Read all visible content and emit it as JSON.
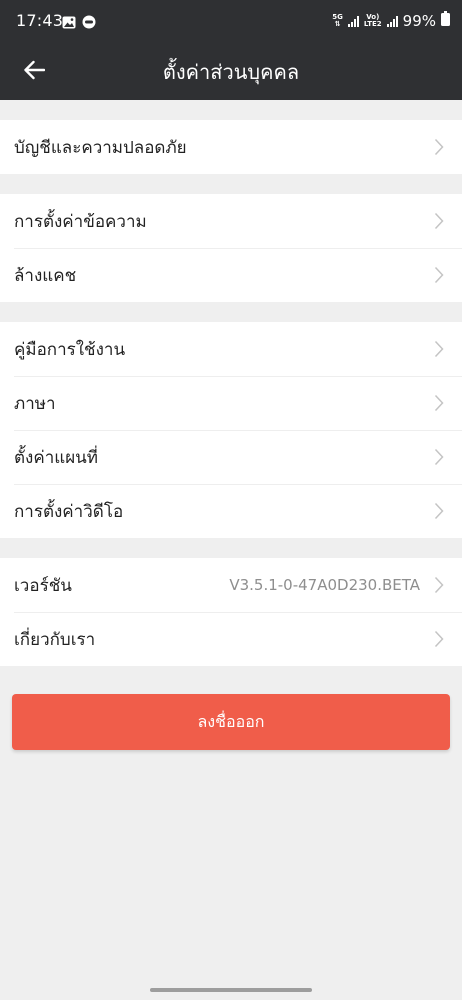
{
  "status_bar": {
    "time": "17:43",
    "net_5g": "5G",
    "volte": "Vo)",
    "lte2": "LTE2",
    "battery": "99%"
  },
  "header": {
    "title": "ตั้งค่าส่วนบุคคล",
    "back_icon": "arrow-left-icon"
  },
  "groups": [
    {
      "rows": [
        {
          "label": "บัญชีและความปลอดภัย"
        }
      ]
    },
    {
      "rows": [
        {
          "label": "การตั้งค่าข้อความ"
        },
        {
          "label": "ล้างแคช"
        }
      ]
    },
    {
      "rows": [
        {
          "label": "คู่มือการใช้งาน"
        },
        {
          "label": "ภาษา"
        },
        {
          "label": "ตั้งค่าแผนที่"
        },
        {
          "label": "การตั้งค่าวิดีโอ"
        }
      ]
    },
    {
      "rows": [
        {
          "label": "เวอร์ชัน",
          "value": "V3.5.1-0-47A0D230.BETA"
        },
        {
          "label": "เกี่ยวกับเรา"
        }
      ]
    }
  ],
  "logout": {
    "label": "ลงชื่อออก"
  },
  "colors": {
    "header_bg": "#2f3033",
    "page_bg": "#efefef",
    "accent": "#f05d4a"
  }
}
